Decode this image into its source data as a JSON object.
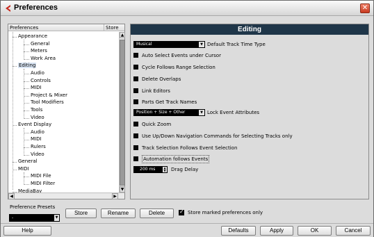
{
  "window": {
    "title": "Preferences",
    "close_glyph": "✕"
  },
  "tree": {
    "header_preferences": "Preferences",
    "header_store": "Store",
    "items": [
      {
        "label": "Appearance",
        "level": 1
      },
      {
        "label": "General",
        "level": 2
      },
      {
        "label": "Meters",
        "level": 2
      },
      {
        "label": "Work Area",
        "level": 2
      },
      {
        "label": "Editing",
        "level": 1,
        "selected": true
      },
      {
        "label": "Audio",
        "level": 2
      },
      {
        "label": "Controls",
        "level": 2
      },
      {
        "label": "MIDI",
        "level": 2
      },
      {
        "label": "Project & Mixer",
        "level": 2
      },
      {
        "label": "Tool Modifiers",
        "level": 2
      },
      {
        "label": "Tools",
        "level": 2
      },
      {
        "label": "Video",
        "level": 2
      },
      {
        "label": "Event Display",
        "level": 1
      },
      {
        "label": "Audio",
        "level": 2
      },
      {
        "label": "MIDI",
        "level": 2
      },
      {
        "label": "Rulers",
        "level": 2
      },
      {
        "label": "Video",
        "level": 2
      },
      {
        "label": "General",
        "level": 1
      },
      {
        "label": "MIDI",
        "level": 1
      },
      {
        "label": "MIDI File",
        "level": 2
      },
      {
        "label": "MIDI Filter",
        "level": 2
      },
      {
        "label": "MediaBay",
        "level": 1
      }
    ]
  },
  "editing": {
    "title": "Editing",
    "time_type_value": "Musical",
    "time_type_label": "Default Track Time Type",
    "options": [
      "Auto Select Events under Cursor",
      "Cycle Follows Range Selection",
      "Delete Overlaps",
      "Link Editors",
      "Parts Get Track Names"
    ],
    "lock_value": "Position + Size + Other",
    "lock_label": "Lock Event Attributes",
    "options2": [
      "Quick Zoom",
      "Use Up/Down Navigation Commands for Selecting Tracks only",
      "Track Selection Follows Event Selection",
      "Automation follows Events"
    ],
    "drag_delay_value": "200 ms",
    "drag_delay_label": "Drag Delay"
  },
  "presets": {
    "label": "Preference Presets",
    "combo_value": "-",
    "store_label": "Store",
    "rename_label": "Rename",
    "delete_label": "Delete",
    "store_marked_label": "Store marked preferences only"
  },
  "footer": {
    "help_label": "Help",
    "defaults_label": "Defaults",
    "apply_label": "Apply",
    "ok_label": "OK",
    "cancel_label": "Cancel"
  },
  "colors": {
    "title_band": "#1f3649",
    "close_button": "#d44a2e",
    "selection": "#d8e4f3"
  },
  "icons": {
    "app": "cubase-logo-icon",
    "close": "close-icon",
    "dropdown": "chevron-down-icon",
    "scroll_up": "arrow-up-icon",
    "scroll_down": "arrow-down-icon",
    "scroll_left": "arrow-left-icon",
    "scroll_right": "arrow-right-icon"
  }
}
